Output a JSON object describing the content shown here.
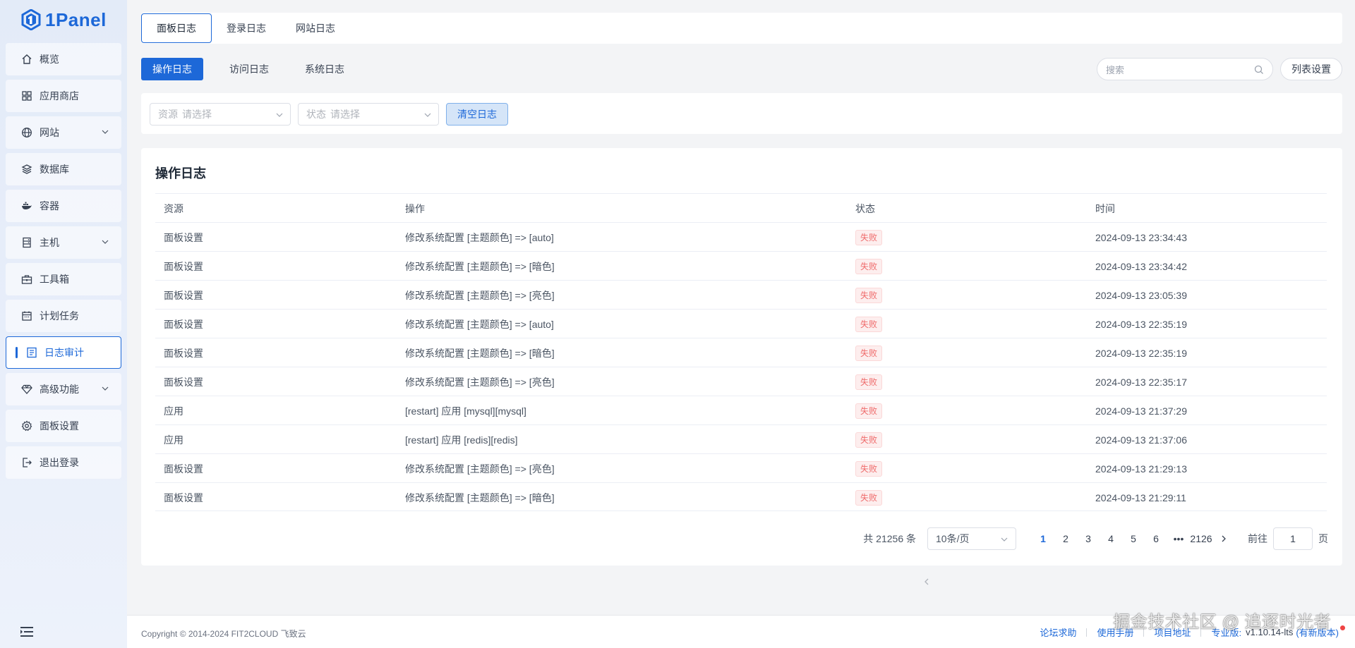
{
  "app": {
    "logo_text": "1Panel"
  },
  "sidebar": {
    "items": [
      {
        "label": "概览",
        "icon": "home-icon",
        "chevron": false,
        "active": false
      },
      {
        "label": "应用商店",
        "icon": "grid-icon",
        "chevron": false,
        "active": false
      },
      {
        "label": "网站",
        "icon": "globe-icon",
        "chevron": true,
        "active": false
      },
      {
        "label": "数据库",
        "icon": "layers-icon",
        "chevron": false,
        "active": false
      },
      {
        "label": "容器",
        "icon": "docker-icon",
        "chevron": false,
        "active": false
      },
      {
        "label": "主机",
        "icon": "server-icon",
        "chevron": true,
        "active": false
      },
      {
        "label": "工具箱",
        "icon": "toolbox-icon",
        "chevron": false,
        "active": false
      },
      {
        "label": "计划任务",
        "icon": "calendar-icon",
        "chevron": false,
        "active": false
      },
      {
        "label": "日志审计",
        "icon": "log-icon",
        "chevron": false,
        "active": true
      },
      {
        "label": "高级功能",
        "icon": "diamond-icon",
        "chevron": true,
        "active": false
      },
      {
        "label": "面板设置",
        "icon": "gear-icon",
        "chevron": false,
        "active": false
      },
      {
        "label": "退出登录",
        "icon": "logout-icon",
        "chevron": false,
        "active": false
      }
    ]
  },
  "top_tabs": [
    "面板日志",
    "登录日志",
    "网站日志"
  ],
  "sub_tabs": [
    "操作日志",
    "访问日志",
    "系统日志"
  ],
  "search": {
    "placeholder": "搜索"
  },
  "list_settings_label": "列表设置",
  "filters": {
    "resource": {
      "prefix": "资源",
      "placeholder": "请选择"
    },
    "status": {
      "prefix": "状态",
      "placeholder": "请选择"
    },
    "clear_label": "清空日志"
  },
  "panel_title": "操作日志",
  "table": {
    "columns": [
      "资源",
      "操作",
      "状态",
      "时间"
    ],
    "rows": [
      {
        "resource": "面板设置",
        "operation": "修改系统配置 [主题颜色] => [auto]",
        "status": "失败",
        "time": "2024-09-13 23:34:43"
      },
      {
        "resource": "面板设置",
        "operation": "修改系统配置 [主题颜色] => [暗色]",
        "status": "失败",
        "time": "2024-09-13 23:34:42"
      },
      {
        "resource": "面板设置",
        "operation": "修改系统配置 [主题颜色] => [亮色]",
        "status": "失败",
        "time": "2024-09-13 23:05:39"
      },
      {
        "resource": "面板设置",
        "operation": "修改系统配置 [主题颜色] => [auto]",
        "status": "失败",
        "time": "2024-09-13 22:35:19"
      },
      {
        "resource": "面板设置",
        "operation": "修改系统配置 [主题颜色] => [暗色]",
        "status": "失败",
        "time": "2024-09-13 22:35:19"
      },
      {
        "resource": "面板设置",
        "operation": "修改系统配置 [主题颜色] => [亮色]",
        "status": "失败",
        "time": "2024-09-13 22:35:17"
      },
      {
        "resource": "应用",
        "operation": "[restart] 应用 [mysql][mysql]",
        "status": "失败",
        "time": "2024-09-13 21:37:29"
      },
      {
        "resource": "应用",
        "operation": "[restart] 应用 [redis][redis]",
        "status": "失败",
        "time": "2024-09-13 21:37:06"
      },
      {
        "resource": "面板设置",
        "operation": "修改系统配置 [主题颜色] => [亮色]",
        "status": "失败",
        "time": "2024-09-13 21:29:13"
      },
      {
        "resource": "面板设置",
        "operation": "修改系统配置 [主题颜色] => [暗色]",
        "status": "失败",
        "time": "2024-09-13 21:29:11"
      }
    ]
  },
  "pagination": {
    "total": "共 21256 条",
    "page_size": "10条/页",
    "pages": [
      "1",
      "2",
      "3",
      "4",
      "5",
      "6",
      "•••",
      "2126"
    ],
    "current": "1",
    "goto_label": "前往",
    "goto_value": "1",
    "page_unit": "页"
  },
  "footer": {
    "copyright": "Copyright © 2014-2024 FIT2CLOUD 飞致云",
    "links": [
      "论坛求助",
      "使用手册",
      "项目地址"
    ],
    "edition": "专业版",
    "version": "v1.10.14-lts",
    "new_version": "(有新版本)"
  },
  "watermark": "掘金技术社区 @ 追逐时光者",
  "colors": {
    "accent": "#1d68d8",
    "danger": "#ef6b6b",
    "danger_bg": "#fdeeee"
  }
}
